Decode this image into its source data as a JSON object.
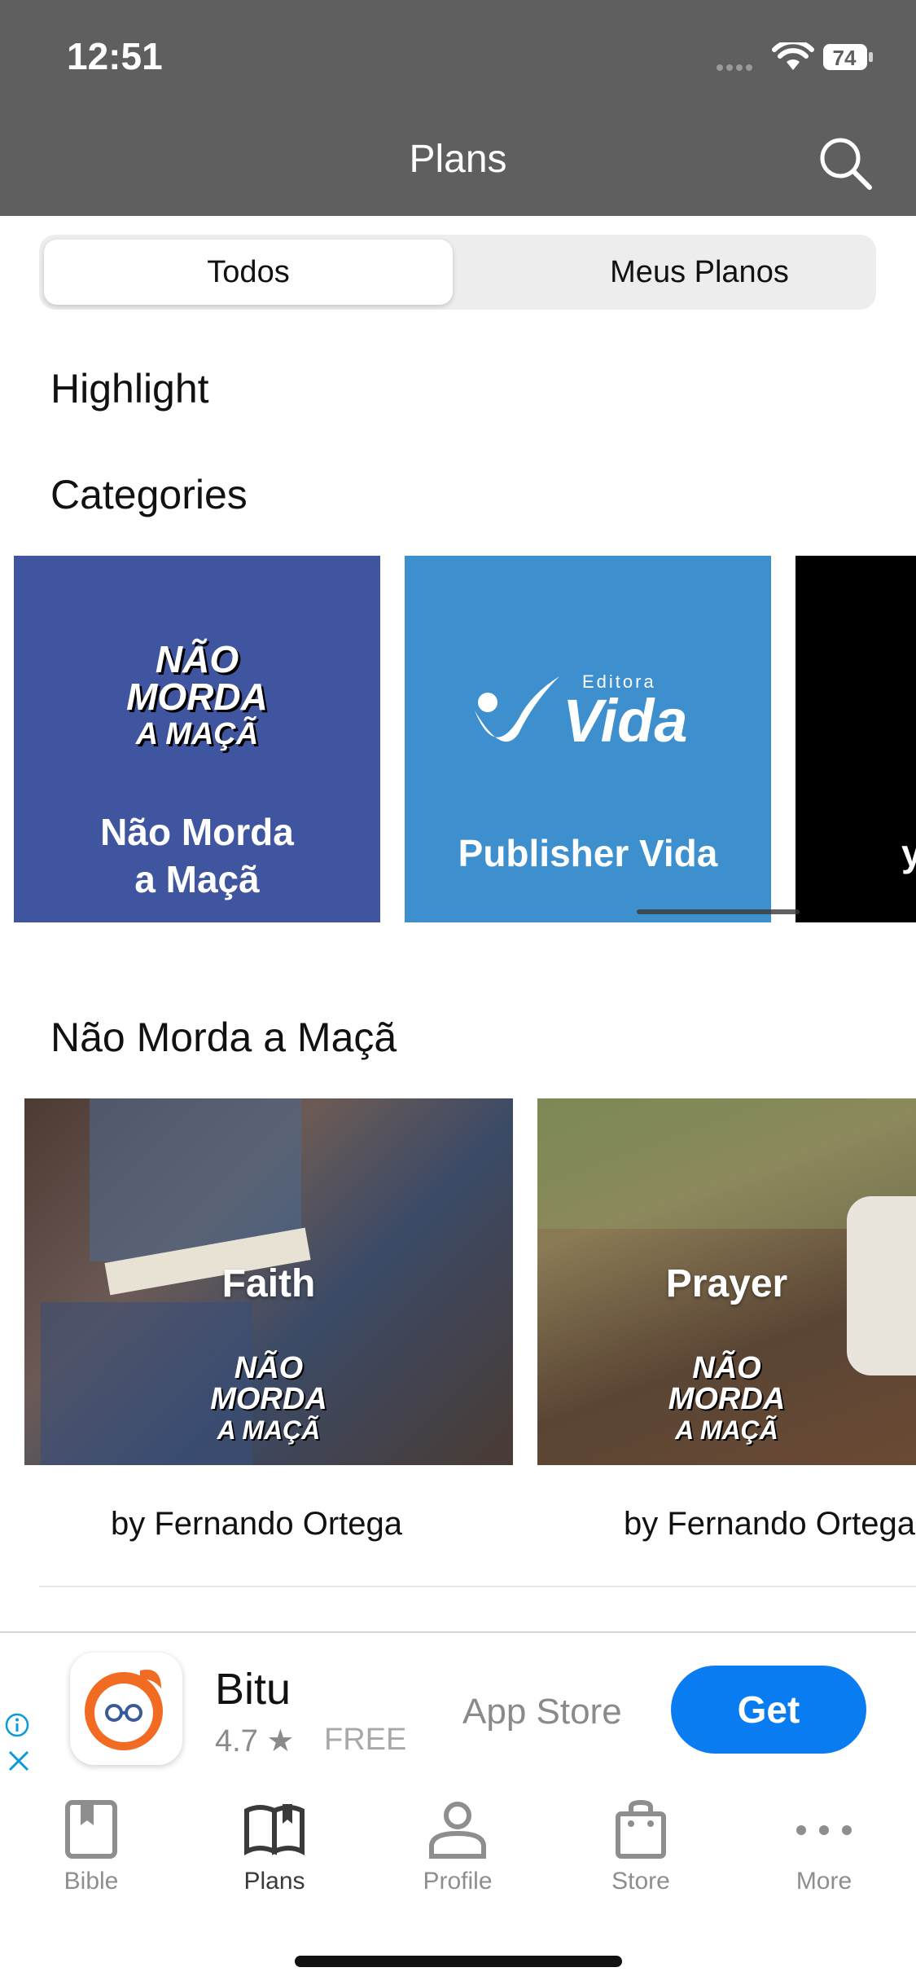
{
  "status_bar": {
    "time": "12:51",
    "battery": "74"
  },
  "header": {
    "title": "Plans",
    "search_icon": "search-icon"
  },
  "segments": {
    "active": "Todos",
    "inactive": "Meus Planos"
  },
  "sections": {
    "highlight": "Highlight",
    "categories": "Categories",
    "nmam": "Não Morda a Maçã"
  },
  "categories": [
    {
      "label": "Não Morda\na Maçã",
      "logo_text": [
        "NÃO",
        "MORDA",
        "A MAÇÃ"
      ],
      "bg": "#3f55a0"
    },
    {
      "label": "Publisher Vida",
      "logo_small": "Editora",
      "logo_big": "Vida",
      "bg": "#3d8fce"
    },
    {
      "label": "y",
      "bg": "#000000"
    }
  ],
  "plans": [
    {
      "title": "Faith",
      "author": "by Fernando Ortega",
      "logo_text": [
        "NÃO",
        "MORDA",
        "A MAÇÃ"
      ]
    },
    {
      "title": "Prayer",
      "author": "by Fernando Ortega",
      "logo_text": [
        "NÃO",
        "MORDA",
        "A MAÇÃ"
      ]
    }
  ],
  "ad": {
    "name": "Bitu",
    "rating": "4.7 ★",
    "price": "FREE",
    "store": "App Store",
    "cta": "Get"
  },
  "tabs": [
    {
      "label": "Bible",
      "icon": "bible-icon"
    },
    {
      "label": "Plans",
      "icon": "plans-icon",
      "active": true
    },
    {
      "label": "Profile",
      "icon": "profile-icon"
    },
    {
      "label": "Store",
      "icon": "store-icon"
    },
    {
      "label": "More",
      "icon": "more-icon"
    }
  ],
  "colors": {
    "header_bg": "#5f5f5f",
    "accent_blue": "#0a7cf2",
    "nmam_blue": "#3f55a0",
    "vida_blue": "#3d8fce"
  }
}
